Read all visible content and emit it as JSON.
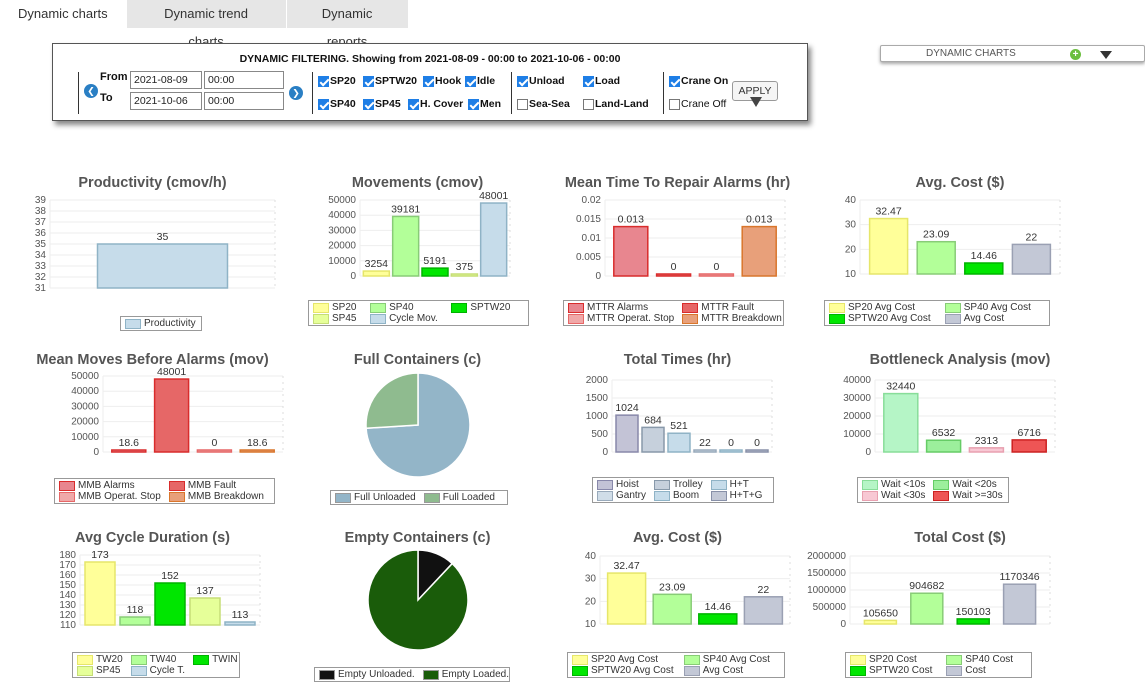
{
  "tabs": [
    "Dynamic charts",
    "Dynamic trend charts",
    "Dynamic reports"
  ],
  "filter": {
    "title": "DYNAMIC FILTERING. Showing from 2021-08-09 - 00:00 to 2021-10-06 - 00:00",
    "from_label": "From",
    "to_label": "To",
    "from_date": "2021-08-09",
    "from_time": "00:00",
    "to_date": "2021-10-06",
    "to_time": "00:00",
    "checkboxes": [
      {
        "label": "SP20",
        "checked": true
      },
      {
        "label": "SPTW20",
        "checked": true
      },
      {
        "label": "Hook",
        "checked": true
      },
      {
        "label": "Idle",
        "checked": true
      },
      {
        "label": "SP40",
        "checked": true
      },
      {
        "label": "SP45",
        "checked": true
      },
      {
        "label": "H. Cover",
        "checked": true
      },
      {
        "label": "Men",
        "checked": true
      },
      {
        "label": "Unload",
        "checked": true
      },
      {
        "label": "Load",
        "checked": true
      },
      {
        "label": "Sea-Sea",
        "checked": false
      },
      {
        "label": "Land-Land",
        "checked": false
      },
      {
        "label": "Crane On",
        "checked": true
      },
      {
        "label": "Crane Off",
        "checked": false
      }
    ],
    "apply_label": "APPLY"
  },
  "dropdown": {
    "label": "DYNAMIC CHARTS"
  },
  "colors": {
    "yellow": "#ffff99",
    "lightgreen": "#b3ff99",
    "green": "#00e600",
    "lightblue": "#c6dcea",
    "red": "#e66767",
    "darkred": "#d92c2c",
    "pink": "#f0a8a8",
    "orange": "#e8956a",
    "slate": "#c3c8d6",
    "pieblue": "#8fb3c6",
    "piegreen": "#8fbf8f",
    "black": "#111111",
    "darkgreen": "#1a5c0a",
    "wait10": "#b5f5c6",
    "wait20": "#90ee90",
    "wait30": "#f8c8d4",
    "wait30plus": "#ee5555"
  },
  "chart_data": [
    {
      "id": "productivity",
      "type": "bar",
      "title": "Productivity (cmov/h)",
      "yticks": [
        "39",
        "38",
        "37",
        "36",
        "35",
        "34",
        "33",
        "32",
        "31"
      ],
      "ylim": [
        31,
        39
      ],
      "series": [
        {
          "name": "Productivity",
          "values": [
            35
          ],
          "labels": [
            "35"
          ],
          "color": "#c6dcea",
          "stroke": "#8fb3c6"
        }
      ]
    },
    {
      "id": "movements",
      "type": "bar",
      "title": "Movements (cmov)",
      "yticks": [
        "50000",
        "40000",
        "30000",
        "20000",
        "10000",
        "0"
      ],
      "ylim": [
        0,
        50000
      ],
      "series": [
        {
          "name": "SP20",
          "values": [
            3254
          ],
          "labels": [
            "3254"
          ],
          "color": "#ffff99",
          "stroke": "#e6e66a"
        },
        {
          "name": "SP40",
          "values": [
            39181
          ],
          "labels": [
            "39181"
          ],
          "color": "#b3ff99",
          "stroke": "#88cc77"
        },
        {
          "name": "SPTW20",
          "values": [
            5191
          ],
          "labels": [
            "5191"
          ],
          "color": "#00e600",
          "stroke": "#00b300"
        },
        {
          "name": "SP45",
          "values": [
            375
          ],
          "labels": [
            "375"
          ],
          "color": "#e6ff99",
          "stroke": "#c6dd77"
        },
        {
          "name": "Cycle Mov.",
          "values": [
            48001
          ],
          "labels": [
            "48001"
          ],
          "color": "#c6dcea",
          "stroke": "#8fb3c6"
        }
      ]
    },
    {
      "id": "mttr",
      "type": "bar",
      "title": "Mean Time To Repair Alarms (hr)",
      "yticks": [
        "0.02",
        "0.015",
        "0.01",
        "0.005",
        "0"
      ],
      "ylim": [
        0,
        0.02
      ],
      "series": [
        {
          "name": "MTTR Alarms",
          "values": [
            0.013
          ],
          "labels": [
            "0.013"
          ],
          "color": "#e8868f",
          "stroke": "#d92c2c"
        },
        {
          "name": "MTTR Fault",
          "values": [
            0
          ],
          "labels": [
            "0"
          ],
          "color": "#e66767",
          "stroke": "#d92c2c"
        },
        {
          "name": "MTTR Operat. Stop",
          "values": [
            0
          ],
          "labels": [
            "0"
          ],
          "color": "#f0a8a8",
          "stroke": "#e66767"
        },
        {
          "name": "MTTR Breakdown",
          "values": [
            0.013
          ],
          "labels": [
            "0.013"
          ],
          "color": "#e8a07a",
          "stroke": "#d9762c"
        }
      ]
    },
    {
      "id": "avgcost1",
      "type": "bar",
      "title": "Avg. Cost ($)",
      "yticks": [
        "40",
        "30",
        "20",
        "10"
      ],
      "ylim": [
        10,
        40
      ],
      "series": [
        {
          "name": "SP20 Avg Cost",
          "values": [
            32.47
          ],
          "labels": [
            "32.47"
          ],
          "color": "#ffff99",
          "stroke": "#e6e66a"
        },
        {
          "name": "SP40 Avg Cost",
          "values": [
            23.09
          ],
          "labels": [
            "23.09"
          ],
          "color": "#b3ff99",
          "stroke": "#88cc77"
        },
        {
          "name": "SPTW20 Avg Cost",
          "values": [
            14.46
          ],
          "labels": [
            "14.46"
          ],
          "color": "#00e600",
          "stroke": "#00b300"
        },
        {
          "name": "Avg Cost",
          "values": [
            22
          ],
          "labels": [
            "22"
          ],
          "color": "#c3c8d6",
          "stroke": "#9aa0b3"
        }
      ]
    },
    {
      "id": "mmba",
      "type": "bar",
      "title": "Mean Moves Before Alarms (mov)",
      "yticks": [
        "50000",
        "40000",
        "30000",
        "20000",
        "10000",
        "0"
      ],
      "ylim": [
        0,
        50000
      ],
      "series": [
        {
          "name": "MMB Alarms",
          "values": [
            18.6
          ],
          "labels": [
            "18.6"
          ],
          "color": "#e8868f",
          "stroke": "#d92c2c"
        },
        {
          "name": "MMB Fault",
          "values": [
            48001
          ],
          "labels": [
            "48001"
          ],
          "color": "#e66767",
          "stroke": "#d92c2c"
        },
        {
          "name": "MMB Operat. Stop",
          "values": [
            0
          ],
          "labels": [
            "0"
          ],
          "color": "#f0a8a8",
          "stroke": "#e66767"
        },
        {
          "name": "MMB Breakdown",
          "values": [
            18.6
          ],
          "labels": [
            "18.6"
          ],
          "color": "#e8a07a",
          "stroke": "#d9762c"
        }
      ]
    },
    {
      "id": "fullcont",
      "type": "pie",
      "title": "Full Containers (c)",
      "series": [
        {
          "name": "Full Unloaded",
          "value": 74,
          "color": "#93b5c8"
        },
        {
          "name": "Full Loaded",
          "value": 26,
          "color": "#8fbb8f"
        }
      ]
    },
    {
      "id": "totaltimes",
      "type": "bar",
      "title": "Total Times (hr)",
      "yticks": [
        "2000",
        "1500",
        "1000",
        "500",
        "0"
      ],
      "ylim": [
        0,
        2000
      ],
      "series": [
        {
          "name": "Hoist",
          "values": [
            1024
          ],
          "labels": [
            "1024"
          ],
          "color": "#c3c3d6",
          "stroke": "#8888aa"
        },
        {
          "name": "Trolley",
          "values": [
            684
          ],
          "labels": [
            "684"
          ],
          "color": "#c6d0dc",
          "stroke": "#8899aa"
        },
        {
          "name": "H+T",
          "values": [
            521
          ],
          "labels": [
            "521"
          ],
          "color": "#c6dcea",
          "stroke": "#8fb3c6"
        },
        {
          "name": "Gantry",
          "values": [
            22
          ],
          "labels": [
            "22"
          ],
          "color": "#d0dde8",
          "stroke": "#99aabb"
        },
        {
          "name": "Boom",
          "values": [
            0
          ],
          "labels": [
            "0"
          ],
          "color": "#c6dcea",
          "stroke": "#8fb3c6"
        },
        {
          "name": "H+T+G",
          "values": [
            0
          ],
          "labels": [
            "0"
          ],
          "color": "#c3c8d6",
          "stroke": "#8890a8"
        }
      ]
    },
    {
      "id": "bottleneck",
      "type": "bar",
      "title": "Bottleneck Analysis (mov)",
      "yticks": [
        "40000",
        "30000",
        "20000",
        "10000",
        "0"
      ],
      "ylim": [
        0,
        40000
      ],
      "series": [
        {
          "name": "Wait <10s",
          "values": [
            32440
          ],
          "labels": [
            "32440"
          ],
          "color": "#b5f5c6",
          "stroke": "#88dd99"
        },
        {
          "name": "Wait <20s",
          "values": [
            6532
          ],
          "labels": [
            "6532"
          ],
          "color": "#9cef9c",
          "stroke": "#66cc66"
        },
        {
          "name": "Wait <30s",
          "values": [
            2313
          ],
          "labels": [
            "2313"
          ],
          "color": "#f8c8d4",
          "stroke": "#e8a0b0"
        },
        {
          "name": "Wait >=30s",
          "values": [
            6716
          ],
          "labels": [
            "6716"
          ],
          "color": "#ee5555",
          "stroke": "#cc2222"
        }
      ]
    },
    {
      "id": "cycle",
      "type": "bar",
      "title": "Avg Cycle Duration (s)",
      "yticks": [
        "180",
        "170",
        "160",
        "150",
        "140",
        "130",
        "120",
        "110"
      ],
      "ylim": [
        110,
        180
      ],
      "series": [
        {
          "name": "TW20",
          "values": [
            173
          ],
          "labels": [
            "173"
          ],
          "color": "#ffff99",
          "stroke": "#e6e66a"
        },
        {
          "name": "TW40",
          "values": [
            118
          ],
          "labels": [
            "118"
          ],
          "color": "#b3ff99",
          "stroke": "#88cc77"
        },
        {
          "name": "TWIN",
          "values": [
            152
          ],
          "labels": [
            "152"
          ],
          "color": "#00e600",
          "stroke": "#00b300"
        },
        {
          "name": "SP45",
          "values": [
            137
          ],
          "labels": [
            "137"
          ],
          "color": "#e6ff99",
          "stroke": "#c6dd77"
        },
        {
          "name": "Cycle T.",
          "values": [
            113
          ],
          "labels": [
            "113"
          ],
          "color": "#c6dcea",
          "stroke": "#8fb3c6"
        }
      ]
    },
    {
      "id": "emptycont",
      "type": "pie",
      "title": "Empty Containers (c)",
      "series": [
        {
          "name": "Empty Unloaded.",
          "value": 12,
          "color": "#111111"
        },
        {
          "name": "Empty Loaded.",
          "value": 88,
          "color": "#1a5c0a"
        }
      ]
    },
    {
      "id": "avgcost2",
      "type": "bar",
      "title": "Avg. Cost ($)",
      "yticks": [
        "40",
        "30",
        "20",
        "10"
      ],
      "ylim": [
        10,
        40
      ],
      "series": [
        {
          "name": "SP20 Avg Cost",
          "values": [
            32.47
          ],
          "labels": [
            "32.47"
          ],
          "color": "#ffff99",
          "stroke": "#e6e66a"
        },
        {
          "name": "SP40 Avg Cost",
          "values": [
            23.09
          ],
          "labels": [
            "23.09"
          ],
          "color": "#b3ff99",
          "stroke": "#88cc77"
        },
        {
          "name": "SPTW20 Avg Cost",
          "values": [
            14.46
          ],
          "labels": [
            "14.46"
          ],
          "color": "#00e600",
          "stroke": "#00b300"
        },
        {
          "name": "Avg Cost",
          "values": [
            22
          ],
          "labels": [
            "22"
          ],
          "color": "#c3c8d6",
          "stroke": "#9aa0b3"
        }
      ]
    },
    {
      "id": "totalcost",
      "type": "bar",
      "title": "Total Cost ($)",
      "yticks": [
        "2000000",
        "1500000",
        "1000000",
        "500000",
        "0"
      ],
      "ylim": [
        0,
        2000000
      ],
      "series": [
        {
          "name": "SP20 Cost",
          "values": [
            105650
          ],
          "labels": [
            "105650"
          ],
          "color": "#ffff99",
          "stroke": "#e6e66a"
        },
        {
          "name": "SP40 Cost",
          "values": [
            904682
          ],
          "labels": [
            "904682"
          ],
          "color": "#b3ff99",
          "stroke": "#88cc77"
        },
        {
          "name": "SPTW20 Cost",
          "values": [
            150103
          ],
          "labels": [
            "150103"
          ],
          "color": "#00e600",
          "stroke": "#00b300"
        },
        {
          "name": "Cost",
          "values": [
            1170346
          ],
          "labels": [
            "1170346"
          ],
          "color": "#c3c8d6",
          "stroke": "#9aa0b3"
        }
      ]
    }
  ]
}
